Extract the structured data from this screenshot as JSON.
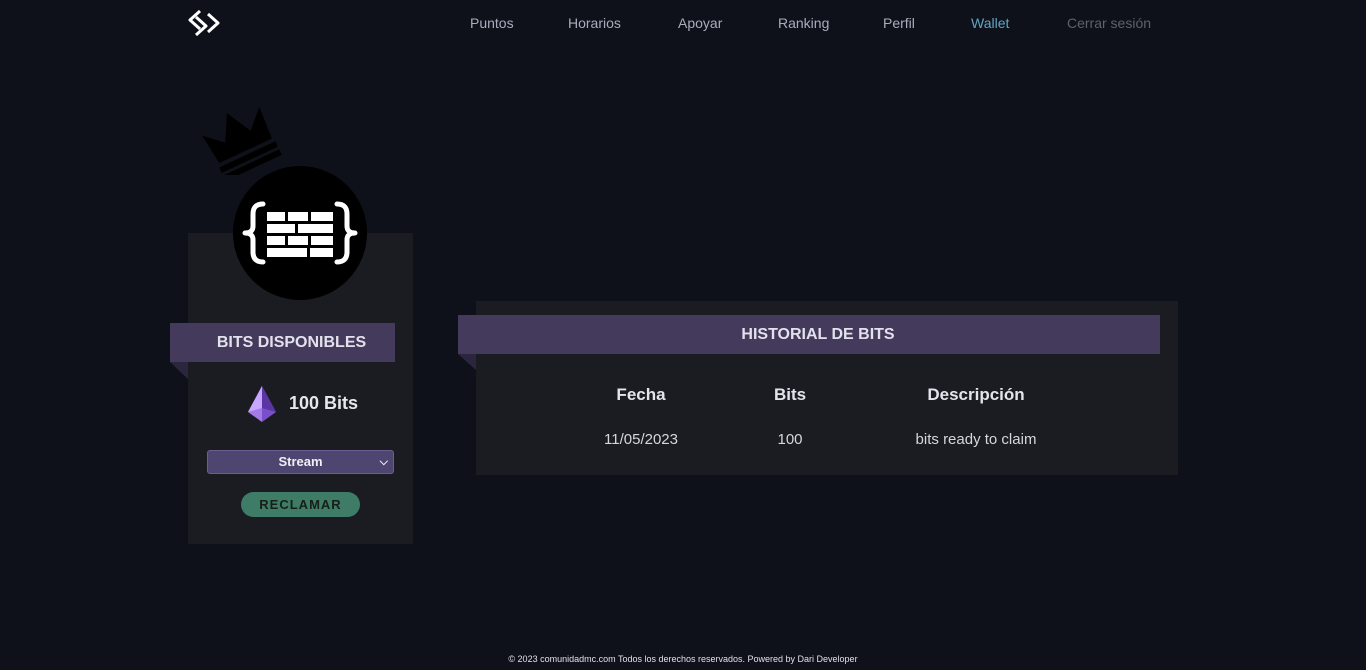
{
  "nav": {
    "items": [
      {
        "label": "Puntos"
      },
      {
        "label": "Horarios"
      },
      {
        "label": "Apoyar"
      },
      {
        "label": "Ranking"
      },
      {
        "label": "Perfil"
      },
      {
        "label": "Wallet"
      },
      {
        "label": "Cerrar sesión"
      }
    ],
    "active": "Wallet"
  },
  "wallet": {
    "title": "BITS DISPONIBLES",
    "amount": "100 Bits",
    "select_value": "Stream",
    "claim_label": "RECLAMAR"
  },
  "history": {
    "title": "HISTORIAL DE BITS",
    "columns": [
      "Fecha",
      "Bits",
      "Descripción"
    ],
    "rows": [
      [
        "11/05/2023",
        "100",
        "bits ready to claim"
      ]
    ]
  },
  "colors": {
    "background": "#0f111a",
    "card": "#1b1c22",
    "ribbon": "#443a5c",
    "active_link": "#5fa7c2",
    "claim_button": "#3f7c67",
    "select": "#4e4570"
  },
  "icons": [
    "site-logo-icon",
    "crown-icon",
    "brick-braces-icon",
    "gem-icon",
    "chevron-down-icon"
  ],
  "footer": {
    "text": "© 2023 comunidadmc.com Todos los derechos reservados. Powered by Dari Developer"
  }
}
